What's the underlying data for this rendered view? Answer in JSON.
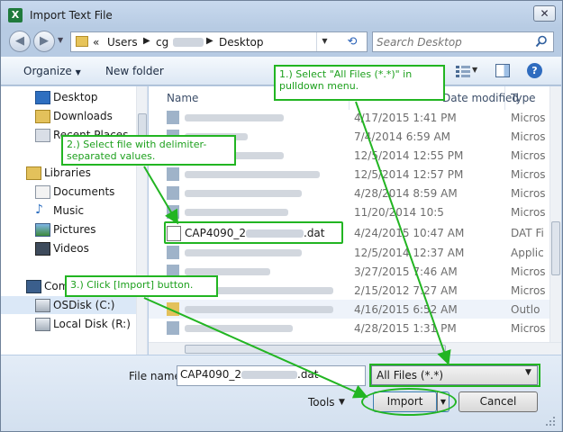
{
  "window": {
    "title": "Import Text File",
    "close_glyph": "✕",
    "app_icon_glyph": "X"
  },
  "address": {
    "nav_prefix": "«",
    "crumbs": [
      "Users",
      "cg",
      "Desktop"
    ],
    "search_placeholder": "Search Desktop"
  },
  "toolbar": {
    "organize": "Organize",
    "new_folder": "New folder",
    "help": "?"
  },
  "nav": {
    "items": [
      {
        "label": "Desktop",
        "icon": "desktop-icon"
      },
      {
        "label": "Downloads",
        "icon": "downloads-icon"
      },
      {
        "label": "Recent Places",
        "icon": "recent-places-icon"
      },
      {
        "label": "Libraries",
        "icon": "libraries-icon"
      },
      {
        "label": "Documents",
        "icon": "documents-icon"
      },
      {
        "label": "Music",
        "icon": "music-icon"
      },
      {
        "label": "Pictures",
        "icon": "pictures-icon"
      },
      {
        "label": "Videos",
        "icon": "videos-icon"
      },
      {
        "label": "Computer",
        "icon": "computer-icon"
      },
      {
        "label": "OSDisk (C:)",
        "icon": "drive-icon"
      },
      {
        "label": "Local Disk (R:)",
        "icon": "drive-icon"
      }
    ]
  },
  "files": {
    "columns": {
      "name": "Name",
      "modified": "Date modified",
      "type": "Type"
    },
    "rows": [
      {
        "name": "",
        "date": "4/17/2015 1:41 PM",
        "type": "Micros"
      },
      {
        "name": "",
        "date": "7/4/2014 6:59 AM",
        "type": "Micros"
      },
      {
        "name": "",
        "date": "12/5/2014 12:55 PM",
        "type": "Micros"
      },
      {
        "name": "",
        "date": "12/5/2014 12:57 PM",
        "type": "Micros"
      },
      {
        "name": "",
        "date": "4/28/2014 8:59 AM",
        "type": "Micros"
      },
      {
        "name": "",
        "date": "11/20/2014 10:5",
        "type": "Micros"
      },
      {
        "name": "CAP4090_2",
        "name_tail": ".dat",
        "date": "4/24/2015 10:47 AM",
        "type": "DAT Fi"
      },
      {
        "name": "",
        "date": "12/5/2014 12:37 AM",
        "type": "Applic"
      },
      {
        "name": "",
        "date": "3/27/2015 7:46 AM",
        "type": "Micros"
      },
      {
        "name": "",
        "date": "2/15/2012 7:27 AM",
        "type": "Micros"
      },
      {
        "name": "",
        "date": "4/16/2015 6:52 AM",
        "type": "Outlo"
      },
      {
        "name": "",
        "date": "4/28/2015 1:31 PM",
        "type": "Micros"
      }
    ]
  },
  "bottom": {
    "filename_label": "File name:",
    "filename_value": "CAP4090_2",
    "filename_tail": ".dat",
    "filetype": "All Files (*.*)",
    "tools": "Tools",
    "import": "Import",
    "cancel": "Cancel"
  },
  "callouts": {
    "step1": "1.) Select \"All Files (*.*)\" in pulldown menu.",
    "step2": "2.) Select file with delimiter-separated values.",
    "step3": "3.) Click [Import] button."
  },
  "colors": {
    "callout": "#22b522",
    "selection": "#dbe8f7"
  }
}
